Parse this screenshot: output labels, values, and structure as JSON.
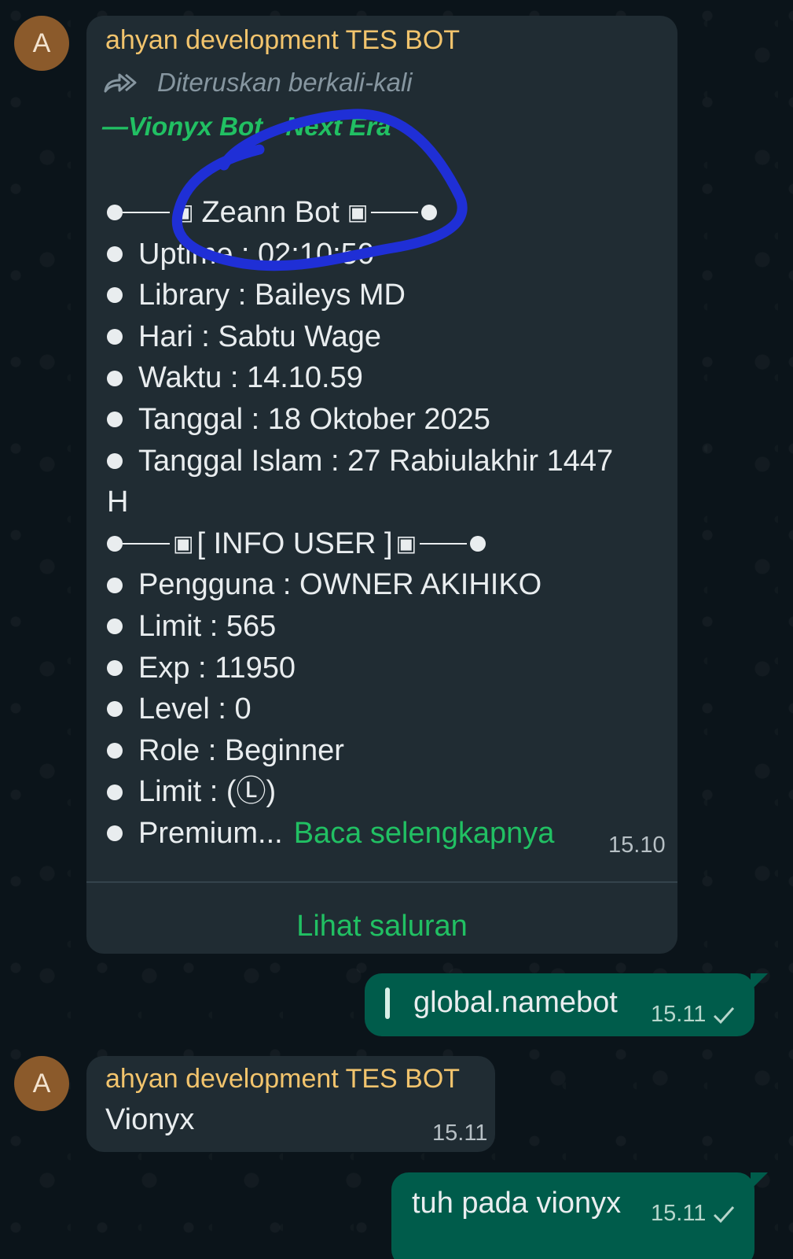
{
  "messages": {
    "forwarded": {
      "avatar_letter": "A",
      "sender": "ahyan development TES BOT",
      "forward_label": "Diteruskan berkali-kali",
      "channel_name": "—Vionyx Bot - Next Era",
      "header_line": "Zeann Bot",
      "lines": [
        "Uptime : 02:10:50",
        "Library : Baileys MD",
        "Hari : Sabtu Wage",
        "Waktu : 14.10.59",
        "Tanggal : 18 Oktober 2025",
        "Tanggal Islam : 27 Rabiulakhir 1447"
      ],
      "wrap_line": "H",
      "info_header": "[ INFO USER ]",
      "user_lines": [
        "Pengguna :  OWNER AKIHIKO",
        "Limit : 565",
        "Exp : 11950",
        "Level : 0",
        "Role : Beginner",
        "Limit : (Ⓛ)"
      ],
      "last_line": "Premium...",
      "read_more": "Baca selengkapnya",
      "time": "15.10",
      "view_channel": "Lihat saluran"
    },
    "out_1": {
      "text": "global.namebot",
      "time": "15.11"
    },
    "reply": {
      "avatar_letter": "A",
      "sender": "ahyan development TES BOT",
      "text": "Vionyx",
      "time": "15.11"
    },
    "out_2": {
      "text": "tuh pada vionyx",
      "time": "15.11"
    }
  },
  "colors": {
    "background": "#0b141a",
    "incoming_bubble": "#202c33",
    "outgoing_bubble": "#005c4b",
    "sender_name": "#f2c46d",
    "accent_green": "#21c063",
    "annotation_circle": "#1f2fd6"
  },
  "icons": [
    "forward-icon",
    "single-check-icon"
  ]
}
